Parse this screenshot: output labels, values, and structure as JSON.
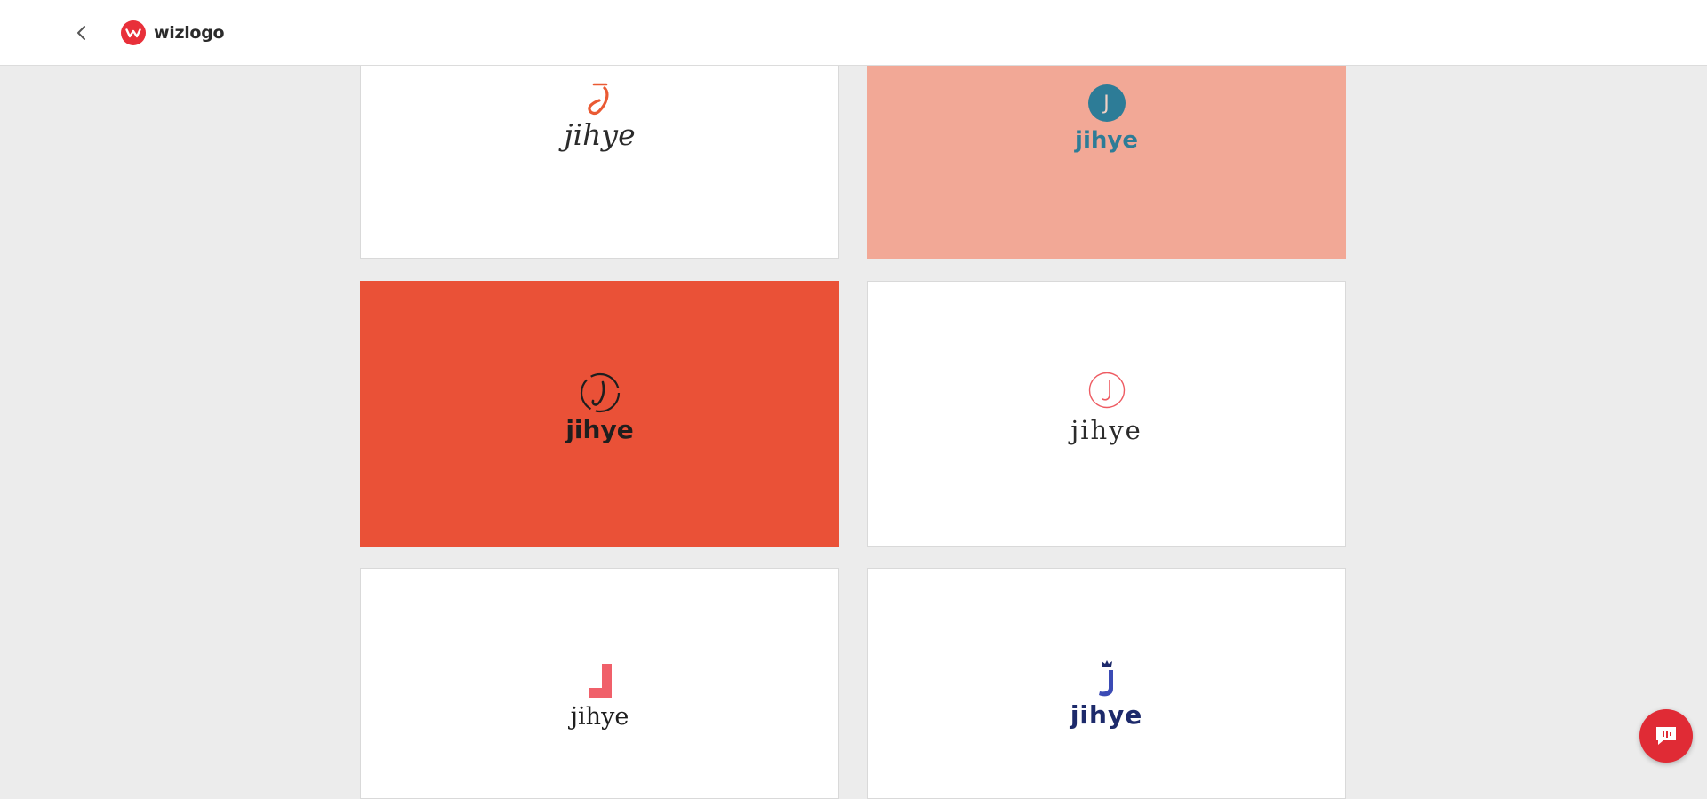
{
  "header": {
    "brand_name": "wizlogo"
  },
  "cards": [
    {
      "wordmark": "jihye",
      "background": "#ffffff"
    },
    {
      "wordmark": "jihye",
      "monogram": "J",
      "background": "#f2a896"
    },
    {
      "wordmark": "jihye",
      "background": "#ea5137"
    },
    {
      "wordmark": "jihye",
      "background": "#ffffff"
    },
    {
      "wordmark": "jihye",
      "background": "#ffffff"
    },
    {
      "wordmark": "jihye",
      "background": "#ffffff"
    }
  ],
  "icons": {
    "back": "chevron-left-icon",
    "brand": "wizlogo-mark-icon",
    "chat": "chat-icon"
  },
  "colors": {
    "brand_red": "#e8303a",
    "orange": "#ea5137",
    "salmon": "#f2a896",
    "teal": "#2d7c97",
    "pink": "#f0606a",
    "navy": "#1d2a6b",
    "indigo": "#3b4bb5"
  }
}
